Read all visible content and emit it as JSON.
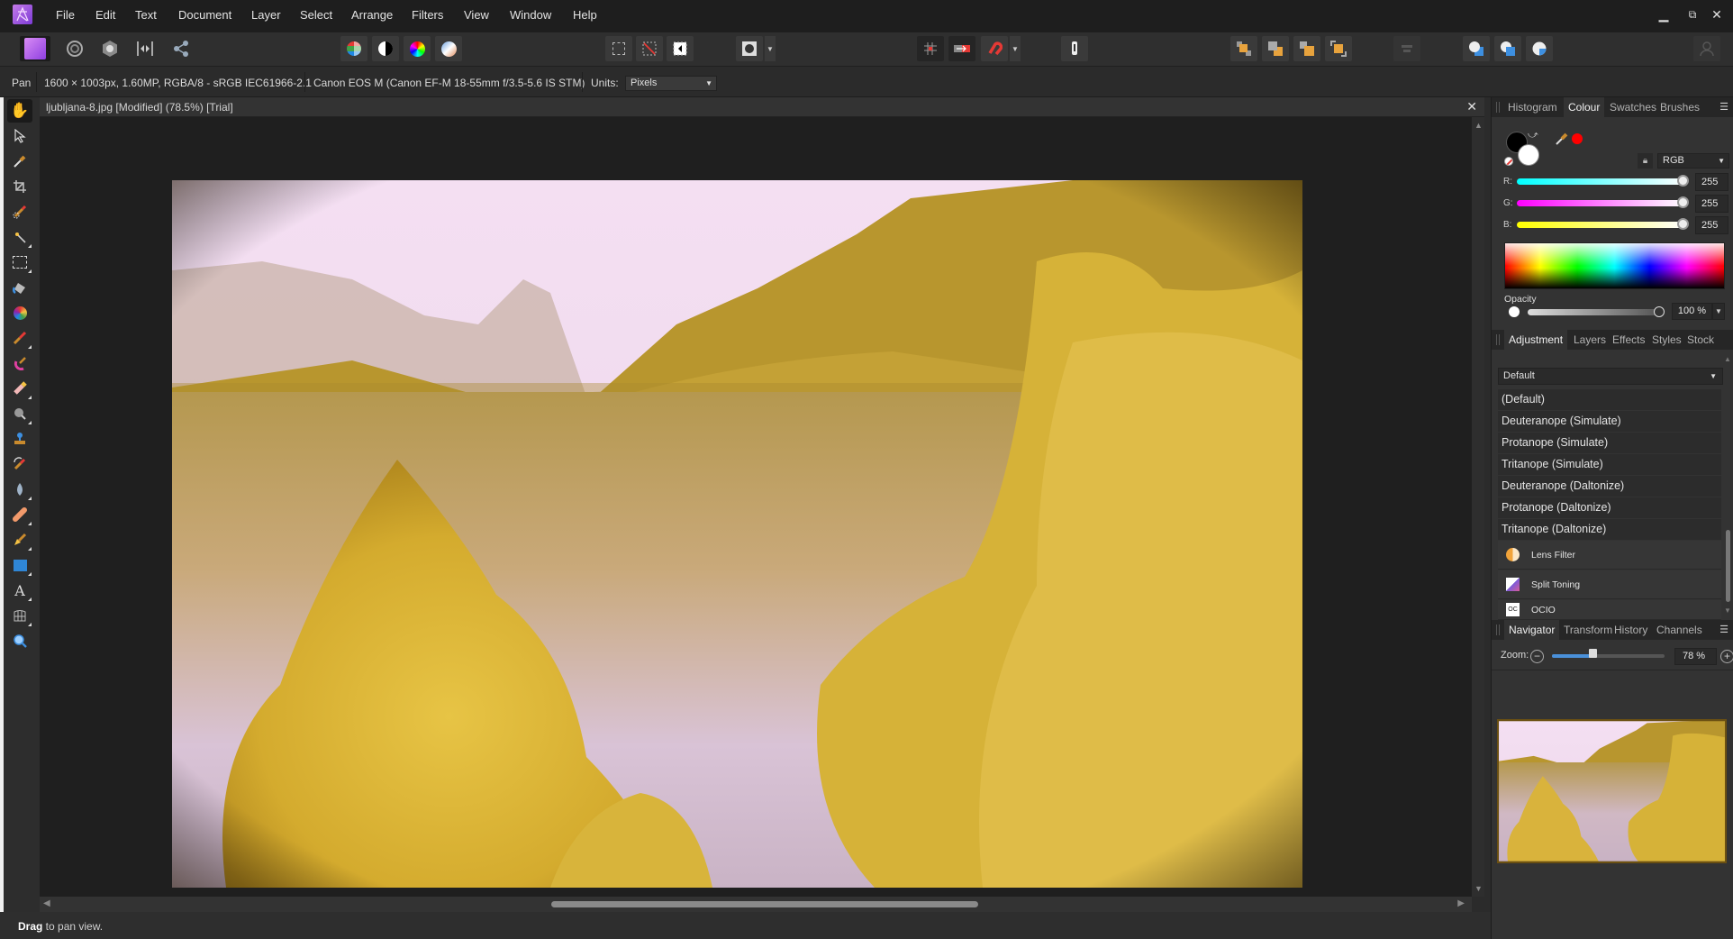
{
  "app": {
    "name": "Affinity Photo",
    "accent": "#b35ef0"
  },
  "menubar": {
    "items": [
      "File",
      "Edit",
      "Text",
      "Document",
      "Layer",
      "Select",
      "Arrange",
      "Filters",
      "View",
      "Window",
      "Help"
    ],
    "window_controls": {
      "minimize": "▁",
      "restore": "⧉",
      "close": "✕"
    }
  },
  "toolbar": {
    "personas": [
      "photo-persona",
      "liquify-persona",
      "develop-persona",
      "tone-mapping-persona",
      "export-persona"
    ],
    "adjust_buttons": [
      "auto-levels",
      "auto-contrast",
      "auto-colours",
      "auto-white-balance"
    ],
    "selection_buttons": [
      "marquee-selection",
      "deselect",
      "invert-selection"
    ],
    "mask_buttons": [
      "quick-mask"
    ],
    "snap_buttons": [
      "grid",
      "force-pixel-alignment",
      "snapping"
    ],
    "assistant_button": "assistant",
    "arrange_buttons": [
      "move-to-back",
      "move-back-one",
      "move-forward-one",
      "move-to-front"
    ],
    "align_button": "alignment",
    "boolean_buttons": [
      "add",
      "subtract",
      "intersect"
    ],
    "account_button": "account"
  },
  "contextbar": {
    "tool": "Pan",
    "doc_info": "1600 × 1003px, 1.60MP, RGBA/8 - sRGB IEC61966-2.1",
    "camera_info": "Canon EOS M (Canon EF-M 18-55mm f/3.5-5.6 IS STM)",
    "units_label": "Units:",
    "units_value": "Pixels"
  },
  "tools": [
    "View Tool",
    "Move Tool",
    "Colour Picker Tool",
    "Crop Tool",
    "Selection Brush Tool",
    "Flood Select Tool",
    "Rectangular Marquee Tool",
    "Flood Fill Tool",
    "Gradient Tool",
    "Paint Brush Tool",
    "Colour Replacement Brush Tool",
    "Erase Brush Tool",
    "Dodge Brush Tool",
    "Clone Brush Tool",
    "Undo Brush Tool",
    "Blur Brush Tool",
    "Healing Brush Tool",
    "Pen Tool",
    "Rectangle Tool",
    "Artistic Text Tool",
    "Mesh Warp Tool",
    "Zoom Tool"
  ],
  "document": {
    "tab_title": "ljubljana-8.jpg [Modified] (78.5%) [Trial]",
    "close": "✕",
    "image_description": "Lake surrounded by golden-yellow trees with pinkish sky and mountains, vignetted edges"
  },
  "statusbar": {
    "bold": "Drag",
    "text": " to pan view."
  },
  "colour_panel": {
    "tabs": [
      "Histogram",
      "Colour",
      "Swatches",
      "Brushes"
    ],
    "active_tab": "Colour",
    "primary_colour": "#000000",
    "secondary_colour": "#ffffff",
    "picked_colour": "#ff0000",
    "mode": "RGB",
    "channels": [
      {
        "label": "R:",
        "value": "255",
        "fraction": 1.0
      },
      {
        "label": "G:",
        "value": "255",
        "fraction": 1.0
      },
      {
        "label": "B:",
        "value": "255",
        "fraction": 1.0
      }
    ],
    "opacity_label": "Opacity",
    "opacity_value": "100 %",
    "opacity_fraction": 1.0
  },
  "adjustment_panel": {
    "tabs": [
      "Adjustment",
      "Layers",
      "Effects",
      "Styles",
      "Stock"
    ],
    "active_tab": "Adjustment",
    "preset_value": "Default",
    "presets": [
      "(Default)",
      "Deuteranope (Simulate)",
      "Protanope (Simulate)",
      "Tritanope (Simulate)",
      "Deuteranope (Daltonize)",
      "Protanope (Daltonize)",
      "Tritanope (Daltonize)"
    ],
    "adjustments": [
      {
        "name": "Lens Filter",
        "icon": "lens-filter-icon"
      },
      {
        "name": "Split Toning",
        "icon": "split-toning-icon"
      },
      {
        "name": "OCIO",
        "icon": "ocio-icon",
        "icon_text": "OC"
      }
    ]
  },
  "navigator_panel": {
    "tabs": [
      "Navigator",
      "Transform",
      "History",
      "Channels"
    ],
    "active_tab": "Navigator",
    "zoom_label": "Zoom:",
    "zoom_value": "78 %",
    "zoom_fraction": 0.4
  }
}
